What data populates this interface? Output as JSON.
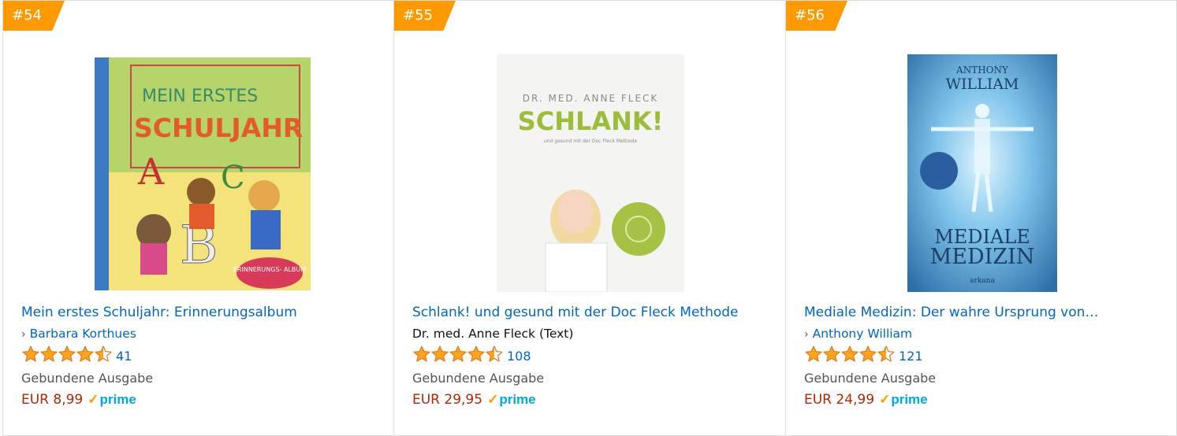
{
  "colors": {
    "rank_badge": "#ff9900",
    "link": "#0066c0",
    "price": "#b12704",
    "prime": "#00a8e1",
    "star": "#ffa41c"
  },
  "products": [
    {
      "rank": "#54",
      "title": "Mein erstes Schuljahr: Erinnerungsalbum",
      "author": "Barbara Korthues",
      "author_is_link": true,
      "rating_stars": 4.5,
      "review_count": "41",
      "format": "Gebundene Ausgabe",
      "price": "EUR 8,99",
      "prime_label": "prime",
      "cover": {
        "line1": "MEIN ERSTES",
        "line2": "SCHULJAHR",
        "badge": "ERINNERUNGS- ALBUM"
      }
    },
    {
      "rank": "#55",
      "title": "Schlank! und gesund mit der Doc Fleck Methode",
      "author": "Dr. med. Anne Fleck (Text)",
      "author_is_link": false,
      "rating_stars": 4.5,
      "review_count": "108",
      "format": "Gebundene Ausgabe",
      "price": "EUR 29,95",
      "prime_label": "prime",
      "cover": {
        "author": "DR. MED. ANNE FLECK",
        "title": "SCHLANK!",
        "subtitle": "und gesund mit der Doc Fleck Methode"
      }
    },
    {
      "rank": "#56",
      "title": "Mediale Medizin: Der wahre Ursprung von…",
      "author": "Anthony William",
      "author_is_link": true,
      "rating_stars": 4.5,
      "review_count": "121",
      "format": "Gebundene Ausgabe",
      "price": "EUR 24,99",
      "prime_label": "prime",
      "cover": {
        "author_first": "ANTHONY",
        "author_last": "WILLIAM",
        "title1": "MEDIALE",
        "title2": "MEDIZIN",
        "publisher": "arkana"
      }
    }
  ]
}
